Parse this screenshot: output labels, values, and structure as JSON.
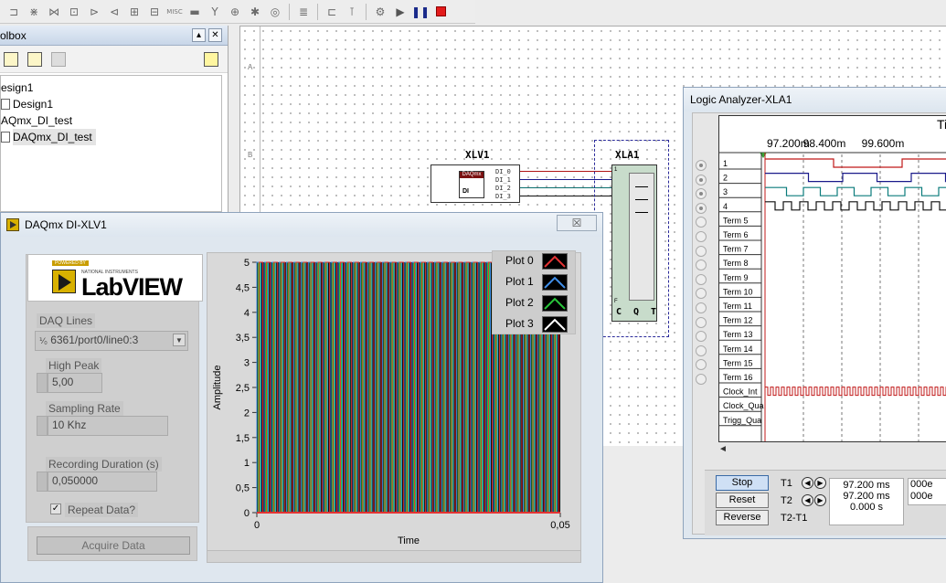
{
  "toolbar": {
    "misc_label": "MISC",
    "icons": [
      "and-gate-icon",
      "resistor-icon",
      "probe-icon",
      "source-icon",
      "switch-icon",
      "diode-icon",
      "ic-icon",
      "meter-icon",
      "misc-icon",
      "display-icon",
      "antenna-icon",
      "transformer-icon",
      "mcu-icon",
      "pin-icon",
      "bus-icon",
      "connector-icon",
      "simulation-icon",
      "play-icon",
      "pause-icon",
      "stop-icon"
    ],
    "stop_color": "#e31b1b"
  },
  "toolbox": {
    "title": "olbox",
    "tree": [
      "esign1",
      "Design1",
      "AQmx_DI_test",
      "DAQmx_DI_test"
    ]
  },
  "schematic": {
    "ruler_labels": [
      "A",
      "B"
    ],
    "xlv1": {
      "label": "XLV1",
      "brand": "DAQmx",
      "icon_text": "DI",
      "pins": [
        "DI_0",
        "DI_1",
        "DI_2",
        "DI_3"
      ]
    },
    "xla1": {
      "label": "XLA1",
      "pins": [
        "C",
        "Q",
        "T"
      ],
      "pin_top": "1",
      "pin_bottom": "F"
    },
    "wire_colors": [
      "#b01515",
      "#1a1a8a",
      "#0a6e6e",
      "#111111"
    ]
  },
  "daq_window": {
    "title": "DAQmx DI-XLV1",
    "close_label": "☒",
    "logo": {
      "powered": "POWERED BY",
      "ni": "NATIONAL INSTRUMENTS",
      "name": "LabVIEW"
    },
    "controls": {
      "daq_lines_label": "DAQ Lines",
      "daq_lines_value": "6361/port0/line0:3",
      "daq_lines_prefix": "⅟₀",
      "high_peak_label": "High Peak",
      "high_peak_value": "5,00",
      "sampling_rate_label": "Sampling Rate",
      "sampling_rate_value": "10 Khz",
      "duration_label": "Recording Duration (s)",
      "duration_value": "0,050000",
      "repeat_label": "Repeat Data?",
      "repeat_checked": "✓",
      "acquire_label": "Acquire Data"
    },
    "legend": [
      {
        "label": "Plot 0",
        "color": "#e33333"
      },
      {
        "label": "Plot 1",
        "color": "#3f8ee8"
      },
      {
        "label": "Plot 2",
        "color": "#28c43a"
      },
      {
        "label": "Plot 3",
        "color": "#ffffff"
      }
    ]
  },
  "chart_data": {
    "type": "line",
    "xlabel": "Time",
    "ylabel": "Amplitude",
    "xlim": [
      0,
      0.05
    ],
    "ylim": [
      0,
      5
    ],
    "x_ticks": [
      "0",
      "0,05"
    ],
    "y_ticks": [
      "0",
      "0,5",
      "1",
      "1,5",
      "2",
      "2,5",
      "3",
      "3,5",
      "4",
      "4,5",
      "5"
    ],
    "pulse_count": 41,
    "series": [
      {
        "name": "Plot 0",
        "values": [
          0,
          5
        ]
      },
      {
        "name": "Plot 1",
        "values": [
          0,
          5
        ]
      },
      {
        "name": "Plot 2",
        "values": [
          0,
          5
        ]
      },
      {
        "name": "Plot 3",
        "values": [
          0,
          5
        ]
      }
    ]
  },
  "logic_analyzer": {
    "title": "Logic Analyzer-XLA1",
    "header_text": "Tin",
    "time_marks": [
      "97.200m",
      "98.400m",
      "99.600m"
    ],
    "channels": [
      "1",
      "2",
      "3",
      "4"
    ],
    "terms": [
      "Term 5",
      "Term 6",
      "Term 7",
      "Term 8",
      "Term 9",
      "Term 10",
      "Term 11",
      "Term 12",
      "Term 13",
      "Term 14",
      "Term 15",
      "Term 16",
      "Clock_Int",
      "Clock_Qua",
      "Trigg_Qua"
    ],
    "channel_colors": [
      "#c01818",
      "#1a1a8a",
      "#0a7b7b",
      "#111111"
    ],
    "scroll_arrow": "◄",
    "buttons": [
      "Stop",
      "Reset",
      "Reverse"
    ],
    "t1_label": "T1",
    "t2_label": "T2",
    "t2t1_label": "T2-T1",
    "t1_value": "97.200 ms",
    "t2_value": "97.200 ms",
    "diff_value": "0.000 s",
    "t1_hex": "000e",
    "t2_hex": "000e"
  }
}
